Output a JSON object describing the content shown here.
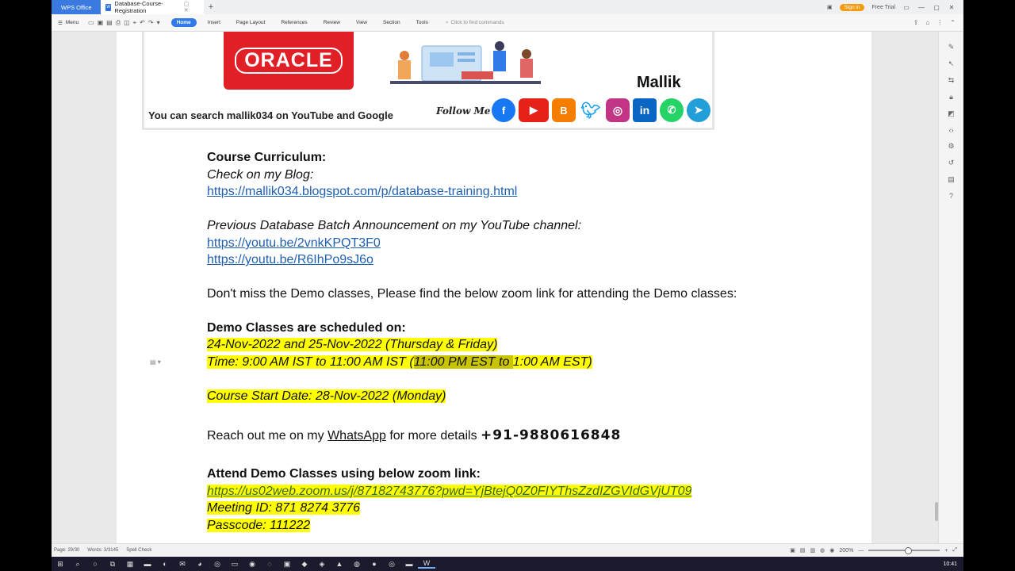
{
  "titlebar": {
    "app_tab": "WPS Office",
    "doc_tab": "Database-Course-Registration",
    "doc_icon": "W",
    "signin": "Sign in",
    "free_trial": "Free Trial"
  },
  "ribbon": {
    "menu": "Menu",
    "tabs": [
      "Home",
      "Insert",
      "Page Layout",
      "References",
      "Review",
      "View",
      "Section",
      "Tools"
    ],
    "find_placeholder": "Click to find commands"
  },
  "banner": {
    "oracle_logo": "ORACLE",
    "name": "Mallik",
    "search_text": "You can search mallik034 on YouTube and Google",
    "follow": "Follow Me @",
    "social_icons": [
      "facebook-icon",
      "youtube-icon",
      "blogger-icon",
      "twitter-icon",
      "instagram-icon",
      "linkedin-icon",
      "whatsapp-icon",
      "telegram-icon"
    ]
  },
  "doc": {
    "curriculum_heading": "Course Curriculum:",
    "blog_label": "Check on my Blog:",
    "blog_link": "https://mallik034.blogspot.com/p/database-training.html",
    "prev_batch_label": "Previous Database Batch Announcement on my YouTube channel:",
    "yt_link1": "https://youtu.be/2vnkKPQT3F0",
    "yt_link2": "https://youtu.be/R6IhPo9sJ6o",
    "demo_note": "Don't miss the Demo classes, Please find the below zoom link for attending the Demo classes:",
    "demo_heading": "Demo Classes are scheduled on:",
    "demo_dates": "24-Nov-2022 and 25-Nov-2022 (Thursday & Friday)",
    "time_part1": "Time: 9:00 AM IST to 11:00 AM IST (",
    "time_part2": "11:00 PM EST to ",
    "time_part3": "1:00 AM EST)",
    "start_date": "Course Start Date: 28-Nov-2022 (Monday)",
    "reach_part1": "Reach out me on my ",
    "reach_whatsapp": "WhatsApp",
    "reach_part2": " for more details ",
    "phone": "+91-9880616848",
    "zoom_heading": "Attend Demo Classes using below zoom link:",
    "zoom_link": "https://us02web.zoom.us/j/87182743776?pwd=YjBtejQ0Z0FIYThsZzdIZGVIdGVjUT09",
    "meeting_id": "Meeting ID: 871 8274 3776",
    "passcode": "Passcode: 111222"
  },
  "statusbar": {
    "page": "Page: 29/30",
    "words": "Words: 3/3145",
    "spell": "Spell Check",
    "zoom": "200%"
  },
  "taskbar": {
    "clock": "10:41"
  },
  "colors": {
    "highlight": "#ffff00",
    "link": "#1f5fb0",
    "oracle_red": "#e01f26",
    "wps_blue": "#3a7ae0"
  }
}
